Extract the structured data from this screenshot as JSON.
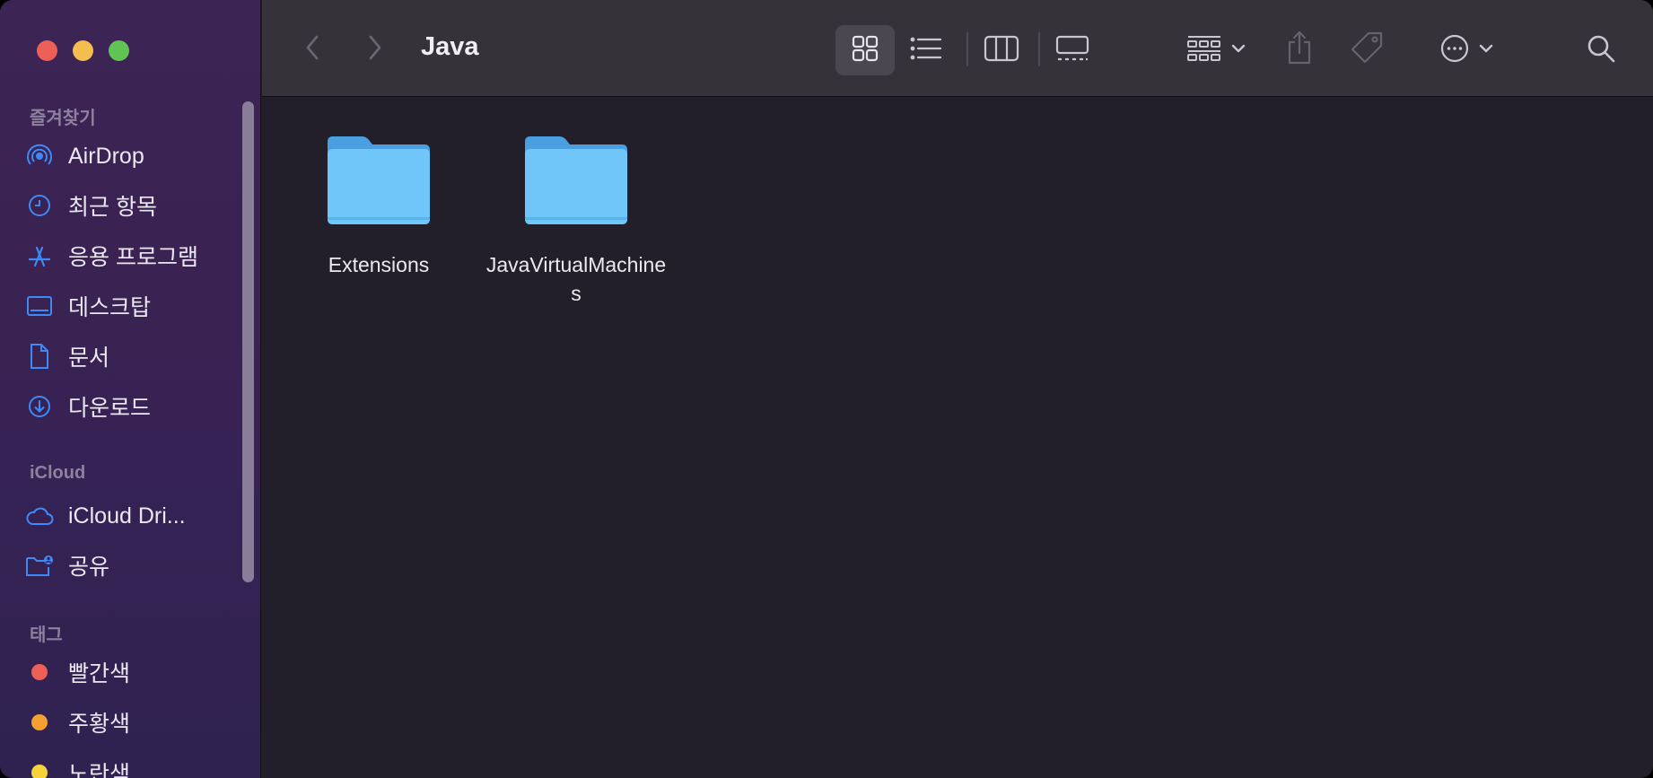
{
  "window": {
    "title": "Java"
  },
  "sidebar": {
    "favorites_title": "즐겨찾기",
    "favorites": [
      {
        "label": "AirDrop",
        "icon": "airdrop-icon"
      },
      {
        "label": "최근 항목",
        "icon": "clock-icon"
      },
      {
        "label": "응용 프로그램",
        "icon": "applications-icon"
      },
      {
        "label": "데스크탑",
        "icon": "desktop-icon"
      },
      {
        "label": "문서",
        "icon": "document-icon"
      },
      {
        "label": "다운로드",
        "icon": "download-icon"
      }
    ],
    "icloud_title": "iCloud",
    "icloud": [
      {
        "label": "iCloud Dri...",
        "icon": "cloud-icon"
      },
      {
        "label": "공유",
        "icon": "shared-folder-icon"
      }
    ],
    "tags_title": "태그",
    "tags": [
      {
        "label": "빨간색",
        "color": "#ee5f57"
      },
      {
        "label": "주황색",
        "color": "#f5a033"
      },
      {
        "label": "노란색",
        "color": "#f6d33c"
      }
    ]
  },
  "toolbar": {
    "view_mode": "icon",
    "icons": [
      "back-icon",
      "forward-icon",
      "icon-view-icon",
      "list-view-icon",
      "column-view-icon",
      "gallery-view-icon",
      "group-icon",
      "share-icon",
      "tag-icon",
      "more-icon",
      "search-icon"
    ]
  },
  "files": [
    {
      "name": "Extensions",
      "icon": "folder-icon"
    },
    {
      "name": "JavaVirtualMachines",
      "icon": "folder-icon"
    }
  ],
  "colors": {
    "accent": "#3d8af7",
    "folder": "#6cc4f6",
    "sidebar": "#3a2352",
    "content": "#221f2b"
  }
}
